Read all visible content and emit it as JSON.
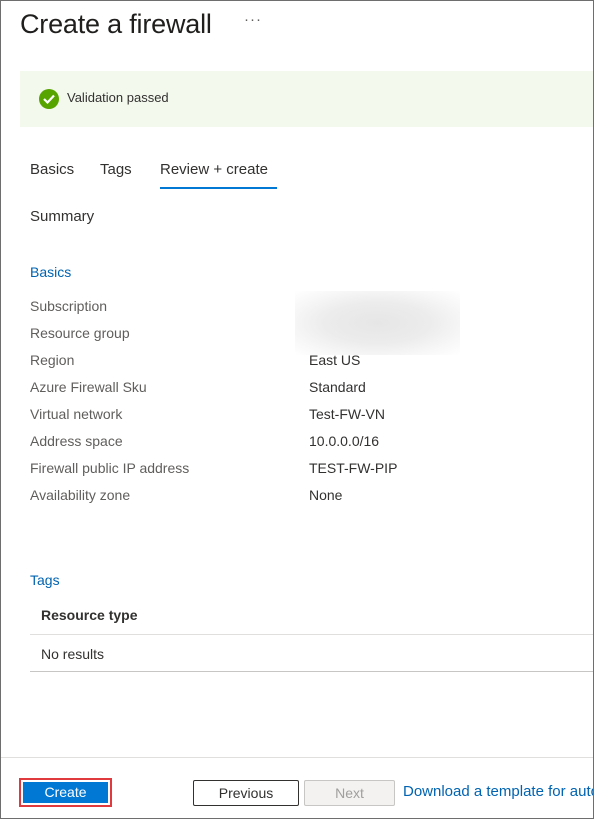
{
  "header": {
    "title": "Create a firewall",
    "more_label": "···"
  },
  "validation": {
    "text": "Validation passed",
    "status_color": "#57a300"
  },
  "tabs": [
    {
      "label": "Basics"
    },
    {
      "label": "Tags"
    },
    {
      "label": "Review + create",
      "selected": true
    }
  ],
  "summary": {
    "title": "Summary",
    "basics_heading": "Basics",
    "rows": [
      {
        "label": "Subscription",
        "value": ""
      },
      {
        "label": "Resource group",
        "value": ""
      },
      {
        "label": "Region",
        "value": "East US"
      },
      {
        "label": "Azure Firewall Sku",
        "value": "Standard"
      },
      {
        "label": "Virtual network",
        "value": "Test-FW-VN"
      },
      {
        "label": "Address space",
        "value": "10.0.0.0/16"
      },
      {
        "label": "Firewall public IP address",
        "value": "TEST-FW-PIP"
      },
      {
        "label": "Availability zone",
        "value": "None"
      }
    ],
    "tags_heading": "Tags",
    "tags_table": {
      "header": "Resource type",
      "empty_text": "No results"
    }
  },
  "footer": {
    "create_label": "Create",
    "previous_label": "Previous",
    "next_label": "Next",
    "download_label": "Download a template for automation"
  },
  "colors": {
    "accent": "#0078d4",
    "link": "#0063b1",
    "highlight_outline": "#e0393e"
  }
}
